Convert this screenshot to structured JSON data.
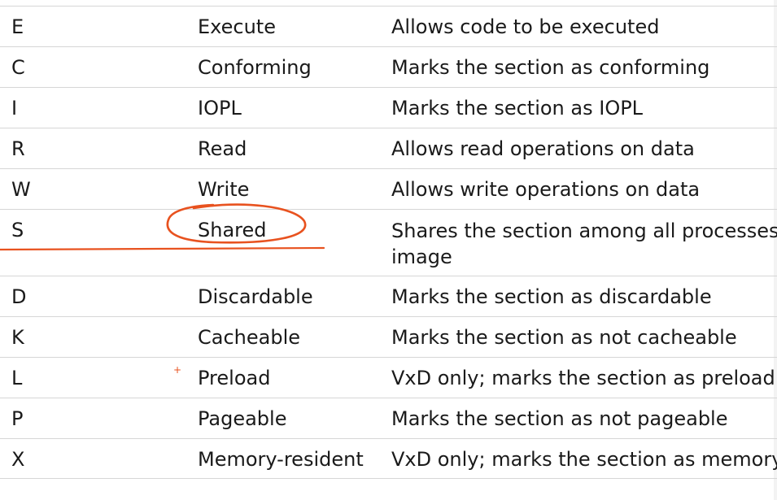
{
  "rows": [
    {
      "flag": "E",
      "name": "Execute",
      "desc": "Allows code to be executed"
    },
    {
      "flag": "C",
      "name": "Conforming",
      "desc": "Marks the section as conforming"
    },
    {
      "flag": "I",
      "name": "IOPL",
      "desc": "Marks the section as IOPL"
    },
    {
      "flag": "R",
      "name": "Read",
      "desc": "Allows read operations on data"
    },
    {
      "flag": "W",
      "name": "Write",
      "desc": "Allows write operations on data"
    },
    {
      "flag": "S",
      "name": "Shared",
      "desc_line1": "Shares the section among all processes using the",
      "desc_line2": "image"
    },
    {
      "flag": "D",
      "name": "Discardable",
      "desc": "Marks the section as discardable"
    },
    {
      "flag": "K",
      "name": "Cacheable",
      "desc": "Marks the section as not cacheable"
    },
    {
      "flag": "L",
      "name": "Preload",
      "desc": "VxD only; marks the section as preload"
    },
    {
      "flag": "P",
      "name": "Pageable",
      "desc": "Marks the section as not pageable"
    },
    {
      "flag": "X",
      "name": "Memory-resident",
      "desc": "VxD only; marks the section as memory-resident"
    }
  ],
  "annotation": {
    "color": "#e8521f",
    "highlighted_row": "Shared",
    "marker_symbol": "+"
  }
}
